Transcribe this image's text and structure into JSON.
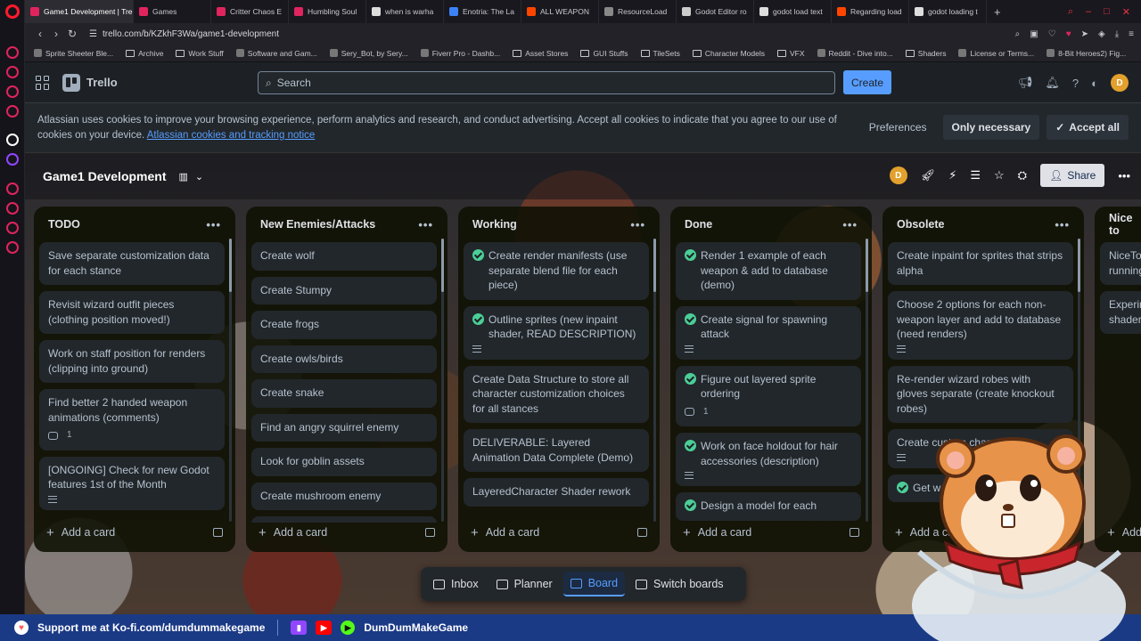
{
  "browser": {
    "tabs": [
      {
        "label": "Game1 Development | Tre",
        "color": "#e0245e",
        "active": true
      },
      {
        "label": "Games",
        "color": "#e0245e"
      },
      {
        "label": "Critter Chaos E",
        "color": "#e0245e"
      },
      {
        "label": "Humbling Soul",
        "color": "#e0245e"
      },
      {
        "label": "when is warha",
        "color": "#dddddd"
      },
      {
        "label": "Enotria: The La",
        "color": "#3b82f6"
      },
      {
        "label": "ALL WEAPON",
        "color": "#ff4500"
      },
      {
        "label": "ResourceLoad",
        "color": "#888888"
      },
      {
        "label": "Godot Editor ro",
        "color": "#cccccc"
      },
      {
        "label": "godot load text",
        "color": "#dddddd"
      },
      {
        "label": "Regarding load",
        "color": "#ff4500"
      },
      {
        "label": "godot loading t",
        "color": "#dddddd"
      }
    ],
    "url": "trello.com/b/KZkhF3Wa/game1-development",
    "bookmarks": [
      "Sprite Sheeter Ble...",
      "Archive",
      "Work Stuff",
      "Software and Gam...",
      "Sery_Bot, by Sery...",
      "Fiverr Pro - Dashb...",
      "Asset Stores",
      "GUI Stuffs",
      "TileSets",
      "Character Models",
      "VFX",
      "Reddit - Dive into...",
      "Shaders",
      "License or Terms...",
      "8-Bit Heroes2) Fig..."
    ]
  },
  "header": {
    "app_name": "Trello",
    "search_placeholder": "Search",
    "create_label": "Create",
    "avatar_initial": "D"
  },
  "cookie": {
    "text": "Atlassian uses cookies to improve your browsing experience, perform analytics and research, and conduct advertising. Accept all cookies to indicate that you agree to our use of cookies on your device.",
    "link": "Atlassian cookies and tracking notice",
    "preferences": "Preferences",
    "only_necessary": "Only necessary",
    "accept_all": "Accept all"
  },
  "board": {
    "title": "Game1 Development",
    "share_label": "Share",
    "avatar_initial": "D",
    "add_card_label": "Add a card",
    "lists": [
      {
        "title": "TODO",
        "cards": [
          {
            "text": "Save separate customization data for each stance"
          },
          {
            "text": "Revisit wizard outfit pieces (clothing position moved!)"
          },
          {
            "text": "Work on staff position for renders (clipping into ground)"
          },
          {
            "text": "Find better 2 handed weapon animations (comments)",
            "comments": "1"
          },
          {
            "text": "[ONGOING] Check for new Godot features 1st of the Month",
            "desc": true
          }
        ]
      },
      {
        "title": "New Enemies/Attacks",
        "cards": [
          {
            "text": "Create wolf"
          },
          {
            "text": "Create Stumpy"
          },
          {
            "text": "Create frogs"
          },
          {
            "text": "Create owls/birds"
          },
          {
            "text": "Create snake"
          },
          {
            "text": "Find an angry squirrel enemy"
          },
          {
            "text": "Look for goblin assets"
          },
          {
            "text": "Create mushroom enemy"
          },
          {
            "text": "Create gryphon mini boss or"
          }
        ]
      },
      {
        "title": "Working",
        "cards": [
          {
            "text": "Create render manifests (use separate blend file for each piece)",
            "done": true
          },
          {
            "text": "Outline sprites (new inpaint shader, READ DESCRIPTION)",
            "done": true,
            "desc": true
          },
          {
            "text": "Create Data Structure to store all character customization choices for all stances"
          },
          {
            "text": "DELIVERABLE: Layered Animation Data Complete (Demo)"
          },
          {
            "text": "LayeredCharacter Shader rework"
          }
        ]
      },
      {
        "title": "Done",
        "cards": [
          {
            "text": "Render 1 example of each weapon & add to database (demo)",
            "done": true
          },
          {
            "text": "Create signal for spawning attack",
            "done": true,
            "desc": true
          },
          {
            "text": "Figure out layered sprite ordering",
            "done": true,
            "comments": "1"
          },
          {
            "text": "Work on face holdout for hair accessories (description)",
            "done": true,
            "desc": true
          },
          {
            "text": "Design a model for each",
            "done": true
          }
        ]
      },
      {
        "title": "Obsolete",
        "cards": [
          {
            "text": "Create inpaint for sprites that strips alpha"
          },
          {
            "text": "Choose 2 options for each non-weapon layer and add to database (need renders)",
            "desc": true
          },
          {
            "text": "Re-render wizard robes with gloves separate (create knockout robes)"
          },
          {
            "text": "Create custom change st",
            "desc": true
          },
          {
            "text": "Get w",
            "done": true
          }
        ]
      },
      {
        "title": "Nice to",
        "cards": [
          {
            "text": "NiceToH running"
          },
          {
            "text": "Experim shader"
          }
        ],
        "add_label": "Add"
      }
    ]
  },
  "bottom_nav": {
    "inbox": "Inbox",
    "planner": "Planner",
    "board": "Board",
    "switch": "Switch boards"
  },
  "stream": {
    "support": "Support me at Ko-fi.com/dumdummakegame",
    "channel": "DumDumMakeGame"
  },
  "colors": {
    "accent": "#579dff",
    "check": "#4bce97",
    "list_bg": "#101204",
    "card_bg": "#22272b",
    "stream_bar": "#1b3a86"
  }
}
